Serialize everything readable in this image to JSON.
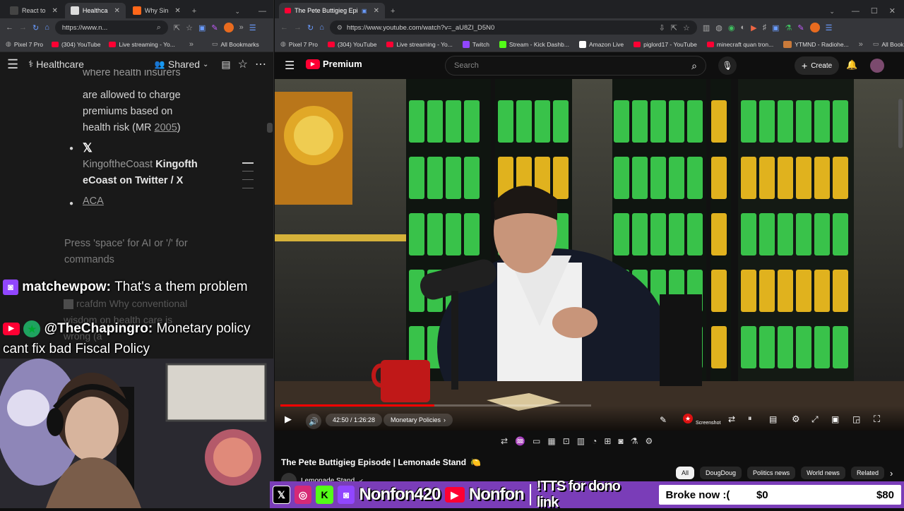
{
  "colors": {
    "youtube_red": "#ff0033",
    "twitch_purple": "#9146ff",
    "kick_green": "#53fc18",
    "instagram": "#d62976",
    "social_bar": "#7a3db8",
    "progress_red": "#ff0000"
  },
  "left_browser": {
    "tabs": [
      {
        "label": "React to",
        "icon": "react-icon",
        "active": false
      },
      {
        "label": "Healthca",
        "icon": "notion-icon",
        "active": true
      },
      {
        "label": "Why Sin",
        "icon": "substack-icon",
        "active": false
      }
    ],
    "url": "https://www.n...",
    "bookmarks": [
      {
        "label": "Pixel 7 Pro"
      },
      {
        "label": "(304) YouTube"
      },
      {
        "label": "Live streaming - Yo..."
      }
    ],
    "all_bookmarks": "All Bookmarks",
    "page_title": "Healthcare",
    "share_label": "Shared",
    "doc": {
      "partial_line": "where health insurers",
      "lines": [
        "are allowed to charge",
        "premiums based on",
        "health risk (MR"
      ],
      "year": "2005",
      "close_paren": ")",
      "link_user": "KingoftheCoast",
      "link_bold_1": "Kingofth",
      "link_bold_2": "eCoast on Twitter / X",
      "aca": "ACA",
      "hint": "Press 'space' for AI or '/' for commands"
    }
  },
  "chat": [
    {
      "user": "matchewpow:",
      "message": "That's a them problem",
      "platform": "twitch"
    },
    {
      "user": "@TheChapingro:",
      "message": "Monetary policy cant fix bad Fiscal Policy",
      "platform": "youtube"
    }
  ],
  "chat_ghost": {
    "user": "rcafdm",
    "text": "Why conventional wisdom on health care is wrong (a"
  },
  "right_browser": {
    "tab_label": "The Pete Buttigieg Episode",
    "url": "https://www.youtube.com/watch?v=_aU8ZI_D5N0",
    "bookmarks": [
      {
        "label": "Pixel 7 Pro"
      },
      {
        "label": "(304) YouTube"
      },
      {
        "label": "Live streaming - Yo..."
      },
      {
        "label": "Twitch"
      },
      {
        "label": "Stream - Kick Dashb..."
      },
      {
        "label": "Amazon Live"
      },
      {
        "label": "piglord17 - YouTube"
      },
      {
        "label": "minecraft quan tron..."
      },
      {
        "label": "YTMND - Radiohe..."
      }
    ],
    "all_bookmarks": "All Bookmarks"
  },
  "youtube": {
    "logo": "Premium",
    "search_placeholder": "Search",
    "create_label": "Create",
    "time": "42:50 / 1:26:28",
    "progress": 0.495,
    "chapter": "Monetary Policies",
    "screenshot_label": "Screenshot",
    "video_title": "The Pete Buttigieg Episode | Lemonade Stand",
    "title_emoji": "🍋",
    "channel": "Lemonade Stand",
    "chips": [
      "All",
      "DougDoug",
      "Politics news",
      "World news",
      "Related"
    ]
  },
  "social_bar": {
    "name_primary": "Nonfon420",
    "name_secondary": "Nonfon",
    "tts": "!TTS for dono link",
    "goal_label": "Broke now :(",
    "goal_current": "$0",
    "goal_target": "$80"
  }
}
